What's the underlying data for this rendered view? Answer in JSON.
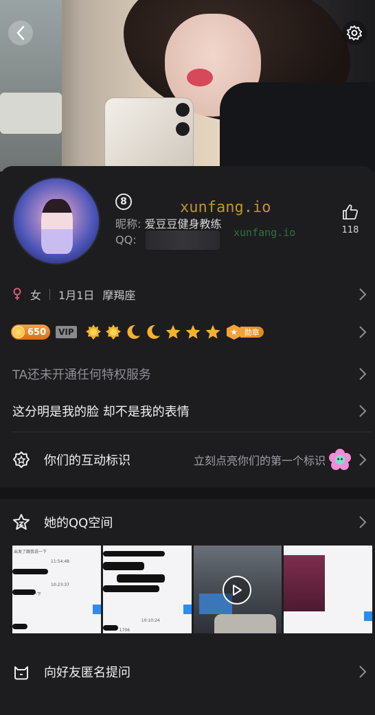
{
  "header": {
    "back_icon": "chevron-left-icon",
    "settings_icon": "gear-icon"
  },
  "profile": {
    "level": "8",
    "nickname_label": "昵称:",
    "nickname": "爱豆豆健身教练",
    "qq_label": "QQ:",
    "likes": "118"
  },
  "watermark": {
    "main": "xunfang.io",
    "secondary": "xunfang.io"
  },
  "info": {
    "gender": "女",
    "birthday": "1月1日",
    "zodiac": "摩羯座"
  },
  "badges": {
    "coins": "650",
    "vip": "VIP",
    "medal": "勋章",
    "level_icons": [
      "sun",
      "sun",
      "moon",
      "moon",
      "star",
      "star",
      "star"
    ]
  },
  "privilege_text": "TA还未开通任何特权服务",
  "signature": "这分明是我的脸 却不是我的表情",
  "interaction": {
    "label": "你们的互动标识",
    "hint": "立刻点亮你们的第一个标识"
  },
  "qzone": {
    "label": "她的QQ空间",
    "thumb_texts": [
      "出发了跟我说一下",
      "11:54:48",
      "10:23:37",
      "一下",
      "10:10:24",
      "1706"
    ]
  },
  "ask": {
    "label": "向好友匿名提问"
  },
  "colors": {
    "background": "#1d1d20",
    "coin": "#f3a23a",
    "watermark": "#c99a2e"
  }
}
